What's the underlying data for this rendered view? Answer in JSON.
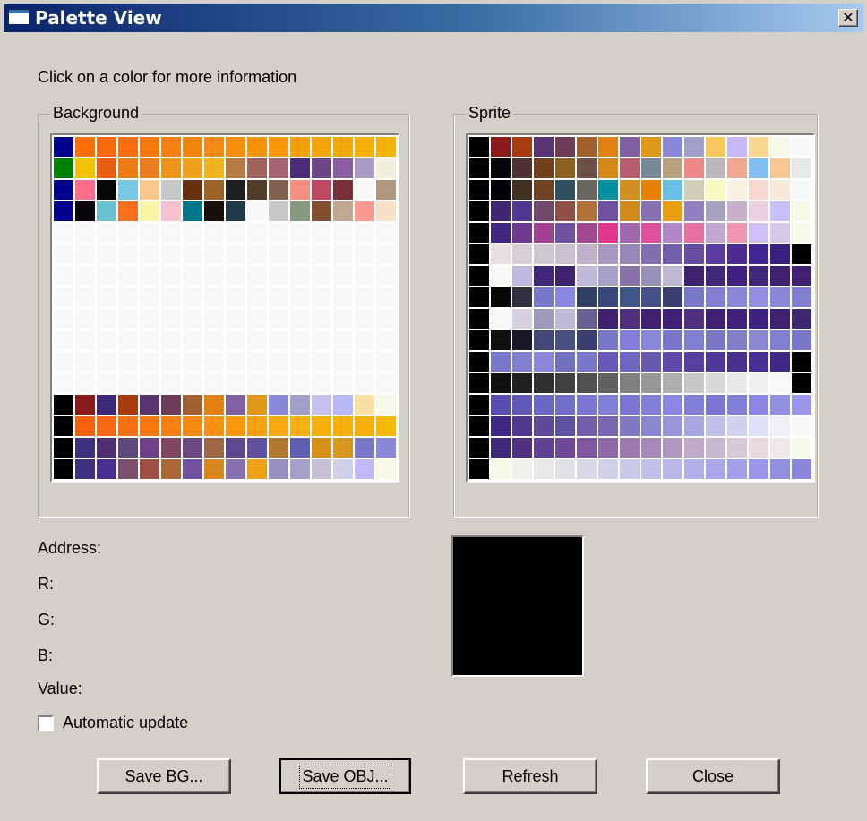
{
  "window": {
    "title": "Palette View",
    "close_glyph": "✕"
  },
  "instruction": "Click on a color for more information",
  "background": {
    "label": "Background",
    "rows": [
      [
        "#00008b",
        "#ff6f00",
        "#f86a0a",
        "#fa6d0d",
        "#f77a10",
        "#f78010",
        "#f4850c",
        "#f58a12",
        "#f78e0d",
        "#f6920a",
        "#f6980a",
        "#f59f08",
        "#f4a607",
        "#f3aa08",
        "#f5b006",
        "#f5b200"
      ],
      [
        "#008000",
        "#f2c200",
        "#e85c10",
        "#ec7c12",
        "#e97d1f",
        "#ed921c",
        "#efa219",
        "#f2b21d",
        "#b77a45",
        "#a0645d",
        "#a46470",
        "#4a2d7a",
        "#6b4584",
        "#8a5ea3",
        "#a89ac2",
        "#f0f0dc"
      ],
      [
        "#00008b",
        "#ff6f8a",
        "#080808",
        "#78c8e8",
        "#f8c88c",
        "#c8c8c8",
        "#643010",
        "#9c6428",
        "#202020",
        "#503c28",
        "#806050",
        "#f89080",
        "#c04860",
        "#783038",
        "#f8f8f8",
        "#b09880"
      ],
      [
        "#00008b",
        "#080808",
        "#68c0d0",
        "#f87020",
        "#f8f4a8",
        "#f8c0d0",
        "#00788c",
        "#181008",
        "#203848",
        "#f8f8f8",
        "#c8c8c8",
        "#889880",
        "#805030",
        "#c0a890",
        "#f89890",
        "#f8e0c8"
      ],
      [
        "#f8f8f8",
        "#f8f8f8",
        "#f8f8f8",
        "#f8f8f8",
        "#f8f8f8",
        "#f8f8f8",
        "#f8f8f8",
        "#f8f8f8",
        "#f8f8f8",
        "#f8f8f8",
        "#f8f8f8",
        "#f8f8f8",
        "#f8f8f8",
        "#f8f8f8",
        "#f8f8f8",
        "#f8f8f8"
      ],
      [
        "#f8f8f8",
        "#f8f8f8",
        "#f8f8f8",
        "#f8f8f8",
        "#f8f8f8",
        "#f8f8f8",
        "#f8f8f8",
        "#f8f8f8",
        "#f8f8f8",
        "#f8f8f8",
        "#f8f8f8",
        "#f8f8f8",
        "#f8f8f8",
        "#f8f8f8",
        "#f8f8f8",
        "#f8f8f8"
      ],
      [
        "#f8f8f8",
        "#f8f8f8",
        "#f8f8f8",
        "#f8f8f8",
        "#f8f8f8",
        "#f8f8f8",
        "#f8f8f8",
        "#f8f8f8",
        "#f8f8f8",
        "#f8f8f8",
        "#f8f8f8",
        "#f8f8f8",
        "#f8f8f8",
        "#f8f8f8",
        "#f8f8f8",
        "#f8f8f8"
      ],
      [
        "#f8f8f8",
        "#f8f8f8",
        "#f8f8f8",
        "#f8f8f8",
        "#f8f8f8",
        "#f8f8f8",
        "#f8f8f8",
        "#f8f8f8",
        "#f8f8f8",
        "#f8f8f8",
        "#f8f8f8",
        "#f8f8f8",
        "#f8f8f8",
        "#f8f8f8",
        "#f8f8f8",
        "#f8f8f8"
      ],
      [
        "#f8f8f8",
        "#f8f8f8",
        "#f8f8f8",
        "#f8f8f8",
        "#f8f8f8",
        "#f8f8f8",
        "#f8f8f8",
        "#f8f8f8",
        "#f8f8f8",
        "#f8f8f8",
        "#f8f8f8",
        "#f8f8f8",
        "#f8f8f8",
        "#f8f8f8",
        "#f8f8f8",
        "#f8f8f8"
      ],
      [
        "#f8f8f8",
        "#f8f8f8",
        "#f8f8f8",
        "#f8f8f8",
        "#f8f8f8",
        "#f8f8f8",
        "#f8f8f8",
        "#f8f8f8",
        "#f8f8f8",
        "#f8f8f8",
        "#f8f8f8",
        "#f8f8f8",
        "#f8f8f8",
        "#f8f8f8",
        "#f8f8f8",
        "#f8f8f8"
      ],
      [
        "#f8f8f8",
        "#f8f8f8",
        "#f8f8f8",
        "#f8f8f8",
        "#f8f8f8",
        "#f8f8f8",
        "#f8f8f8",
        "#f8f8f8",
        "#f8f8f8",
        "#f8f8f8",
        "#f8f8f8",
        "#f8f8f8",
        "#f8f8f8",
        "#f8f8f8",
        "#f8f8f8",
        "#f8f8f8"
      ],
      [
        "#f8f8f8",
        "#f8f8f8",
        "#f8f8f8",
        "#f8f8f8",
        "#f8f8f8",
        "#f8f8f8",
        "#f8f8f8",
        "#f8f8f8",
        "#f8f8f8",
        "#f8f8f8",
        "#f8f8f8",
        "#f8f8f8",
        "#f8f8f8",
        "#f8f8f8",
        "#f8f8f8",
        "#f8f8f8"
      ],
      [
        "#000000",
        "#8b1a1a",
        "#3c2a78",
        "#a83c10",
        "#5a3470",
        "#6e3c58",
        "#a06030",
        "#e08010",
        "#8060a0",
        "#e09818",
        "#8888d8",
        "#a0a0c8",
        "#c8c0f0",
        "#b8b8f8",
        "#f8e0a0",
        "#f8f8e8"
      ],
      [
        "#000000",
        "#f86010",
        "#f86810",
        "#f87010",
        "#f87810",
        "#f88010",
        "#f88810",
        "#f89010",
        "#f89810",
        "#f8a010",
        "#f8a810",
        "#f8b010",
        "#f8b008",
        "#f8b008",
        "#f8b008",
        "#f8b800"
      ],
      [
        "#000000",
        "#403080",
        "#503070",
        "#604878",
        "#704088",
        "#804860",
        "#6a4880",
        "#a06848",
        "#604890",
        "#6050a0",
        "#b07830",
        "#6060b0",
        "#d89018",
        "#d89820",
        "#7878c8",
        "#8888d8"
      ],
      [
        "#000000",
        "#403080",
        "#4a3090",
        "#805070",
        "#a05040",
        "#a86838",
        "#7050a0",
        "#d88820",
        "#8870b0",
        "#f0a018",
        "#9890c0",
        "#a8a0c8",
        "#c8c0d8",
        "#d0d0e8",
        "#c0b8f8",
        "#f8f8e8"
      ]
    ]
  },
  "sprite": {
    "label": "Sprite",
    "rows": [
      [
        "#000000",
        "#8b1a1a",
        "#a83c10",
        "#5a3470",
        "#6e3c58",
        "#a06030",
        "#e08010",
        "#8060a0",
        "#e09818",
        "#8888d8",
        "#a0a0c8",
        "#f8c860",
        "#c8b8f8",
        "#f8d890",
        "#f8f8e8",
        "#f8f8f8"
      ],
      [
        "#000000",
        "#080808",
        "#503030",
        "#70401c",
        "#8c6020",
        "#6c5048",
        "#d48818",
        "#b86070",
        "#788898",
        "#b8a080",
        "#f08888",
        "#b8b8b8",
        "#f0a890",
        "#80c0f0",
        "#f8c890",
        "#e8e8e8"
      ],
      [
        "#000000",
        "#000008",
        "#403020",
        "#704020",
        "#305060",
        "#686860",
        "#0090a0",
        "#d09020",
        "#e88000",
        "#68c0e8",
        "#d0d0b8",
        "#f8f8c0",
        "#f8f0e0",
        "#f8d8d0",
        "#f8e8d8",
        "#f8f8f8"
      ],
      [
        "#000000",
        "#402870",
        "#503890",
        "#704868",
        "#905048",
        "#b07038",
        "#7050a0",
        "#d08820",
        "#8870b0",
        "#e8a010",
        "#9080c0",
        "#a8a0c0",
        "#c8b0c8",
        "#e8d0e0",
        "#c8c0f8",
        "#f8f8e8"
      ],
      [
        "#000000",
        "#402880",
        "#703890",
        "#a04090",
        "#7050a0",
        "#a04890",
        "#e03890",
        "#a068b0",
        "#e050a0",
        "#b088c8",
        "#e870a0",
        "#c0a8d0",
        "#f098b0",
        "#d0c0f8",
        "#d8c8e8",
        "#f8f8e8"
      ],
      [
        "#000000",
        "#e8e0e0",
        "#d8d0d8",
        "#d0c8d0",
        "#c8c0d0",
        "#c0b0c8",
        "#a898c0",
        "#9888b8",
        "#8070b0",
        "#7060a8",
        "#684ca0",
        "#5c3ca0",
        "#4c2c90",
        "#402890",
        "#382080",
        "#000000"
      ],
      [
        "#000000",
        "#f8f8f8",
        "#c0b8e0",
        "#402878",
        "#402070",
        "#c0b8d8",
        "#a8a0c8",
        "#8870a8",
        "#9890b8",
        "#c0b8d0",
        "#402070",
        "#402878",
        "#402080",
        "#402878",
        "#402070",
        "#402070"
      ],
      [
        "#000000",
        "#080808",
        "#303040",
        "#7878c8",
        "#8888e0",
        "#304060",
        "#384878",
        "#405888",
        "#485088",
        "#384070",
        "#7878c8",
        "#8080d0",
        "#8888d8",
        "#9090e0",
        "#8888d8",
        "#8080d0"
      ],
      [
        "#000000",
        "#f8f8f8",
        "#d8d0e0",
        "#a098b8",
        "#c0b8d8",
        "#686090",
        "#402070",
        "#503078",
        "#402070",
        "#402070",
        "#503080",
        "#402070",
        "#402078",
        "#402080",
        "#402070",
        "#402870"
      ],
      [
        "#000000",
        "#101010",
        "#181828",
        "#404878",
        "#485080",
        "#384070",
        "#7878c8",
        "#8080d8",
        "#8888d8",
        "#7878c8",
        "#8080d0",
        "#7878c0",
        "#8080c8",
        "#8888d0",
        "#8080d0",
        "#7878c8"
      ],
      [
        "#000000",
        "#7878c8",
        "#8080d0",
        "#8888d8",
        "#7070c0",
        "#7878c8",
        "#6858b8",
        "#7068c0",
        "#6858b0",
        "#6048a8",
        "#5840a0",
        "#503898",
        "#4c3090",
        "#483090",
        "#402888",
        "#000000"
      ],
      [
        "#000000",
        "#101010",
        "#202020",
        "#303030",
        "#404040",
        "#505050",
        "#606060",
        "#808080",
        "#989898",
        "#b0b0b0",
        "#c8c8c8",
        "#d8d8d8",
        "#e8e8e8",
        "#f0f0f0",
        "#f8f8f8",
        "#000000"
      ],
      [
        "#000000",
        "#5850b0",
        "#6058b8",
        "#6868c0",
        "#7070c8",
        "#7878d0",
        "#8080d8",
        "#7878d0",
        "#8080d8",
        "#8888e0",
        "#8080d8",
        "#7878d0",
        "#8080d8",
        "#8888e0",
        "#9090e0",
        "#9898e8"
      ],
      [
        "#000000",
        "#402880",
        "#503890",
        "#604898",
        "#6050a0",
        "#7060a8",
        "#7868b0",
        "#8078c0",
        "#8888d0",
        "#9898d8",
        "#a8a8e0",
        "#c0c0e8",
        "#d0d0f0",
        "#e0e0f8",
        "#f0f0f8",
        "#f8f8f8"
      ],
      [
        "#000000",
        "#402878",
        "#503080",
        "#604090",
        "#704898",
        "#8058a0",
        "#9068a8",
        "#a078b0",
        "#a888b8",
        "#b098c0",
        "#c0a8c8",
        "#c8b8d0",
        "#d8c8d8",
        "#e8d8e0",
        "#f0e8e8",
        "#f8f8e8"
      ],
      [
        "#000000",
        "#f8f8e8",
        "#f0f0e8",
        "#e8e8e8",
        "#e0e0e8",
        "#d8d8e8",
        "#d0d0e8",
        "#c8c8e8",
        "#c0c0e8",
        "#b8b8e8",
        "#b0b0e8",
        "#a8a8e8",
        "#a0a0e8",
        "#9898e8",
        "#9090e0",
        "#8888d8"
      ]
    ]
  },
  "info": {
    "address": "Address:",
    "r": "R:",
    "g": "G:",
    "b": "B:",
    "value": "Value:"
  },
  "preview_color": "#000000",
  "auto_update": {
    "label": "Automatic update",
    "checked": false
  },
  "buttons": {
    "save_bg": "Save BG...",
    "save_obj": "Save OBJ...",
    "refresh": "Refresh",
    "close": "Close"
  }
}
